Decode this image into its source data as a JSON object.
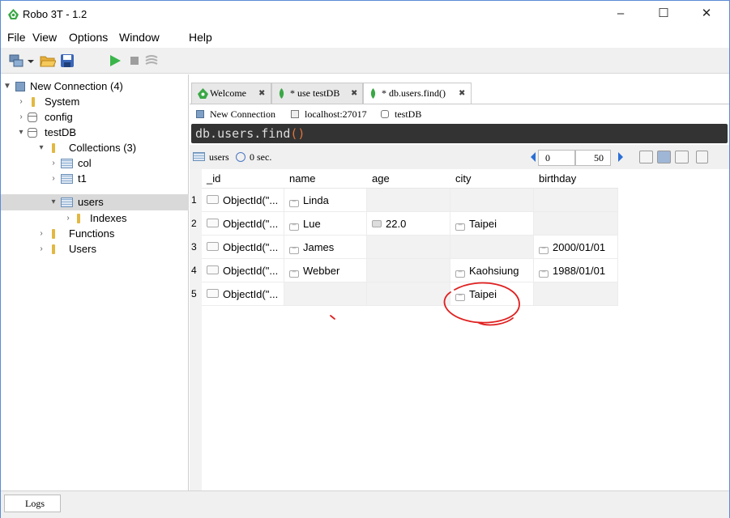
{
  "window": {
    "title": "Robo 3T - 1.2",
    "controls": {
      "minimize": "–",
      "maximize": "☐",
      "close": "✕"
    }
  },
  "menu": [
    "File",
    "View",
    "Options",
    "Window",
    "Help"
  ],
  "toolbar": {
    "icons": [
      "connect-icon",
      "dropdown-icon",
      "open-icon",
      "save-icon",
      "execute-icon",
      "stop-icon",
      "format-icon"
    ]
  },
  "tree": {
    "connection": "New Connection (4)",
    "system": "System",
    "config": "config",
    "testdb": "testDB",
    "collections": "Collections (3)",
    "col": "col",
    "t1": "t1",
    "users": "users",
    "indexes": "Indexes",
    "functions": "Functions",
    "usersFolder": "Users"
  },
  "tabs": [
    {
      "label": "Welcome"
    },
    {
      "label": "* use testDB"
    },
    {
      "label": "* db.users.find()"
    }
  ],
  "tab_close": "✖",
  "breadcrumb": {
    "connection": "New Connection",
    "host": "localhost:27017",
    "db": "testDB"
  },
  "command": {
    "text": "db.users.find",
    "parens": "()"
  },
  "result": {
    "collection": "users",
    "time": "0 sec.",
    "skip": "0",
    "limit": "50"
  },
  "table": {
    "headers": [
      "_id",
      "name",
      "age",
      "city",
      "birthday"
    ],
    "rows": [
      {
        "num": "1",
        "id": "ObjectId(\"...",
        "name": "Linda",
        "age": "",
        "city": "",
        "birthday": ""
      },
      {
        "num": "2",
        "id": "ObjectId(\"...",
        "name": "Lue",
        "age": "22.0",
        "city": "Taipei",
        "birthday": ""
      },
      {
        "num": "3",
        "id": "ObjectId(\"...",
        "name": "James",
        "age": "",
        "city": "",
        "birthday": "2000/01/01"
      },
      {
        "num": "4",
        "id": "ObjectId(\"...",
        "name": "Webber",
        "age": "",
        "city": "Kaohsiung",
        "birthday": "1988/01/01"
      },
      {
        "num": "5",
        "id": "ObjectId(\"...",
        "name": "",
        "age": "",
        "city": "Taipei",
        "birthday": ""
      }
    ]
  },
  "logs": "Logs",
  "colors": {
    "accent": "#2a6fd6",
    "command_bg": "#333333",
    "paren": "#e0733c",
    "annotation": "#e02020",
    "leaf_green": "#3aa845"
  }
}
